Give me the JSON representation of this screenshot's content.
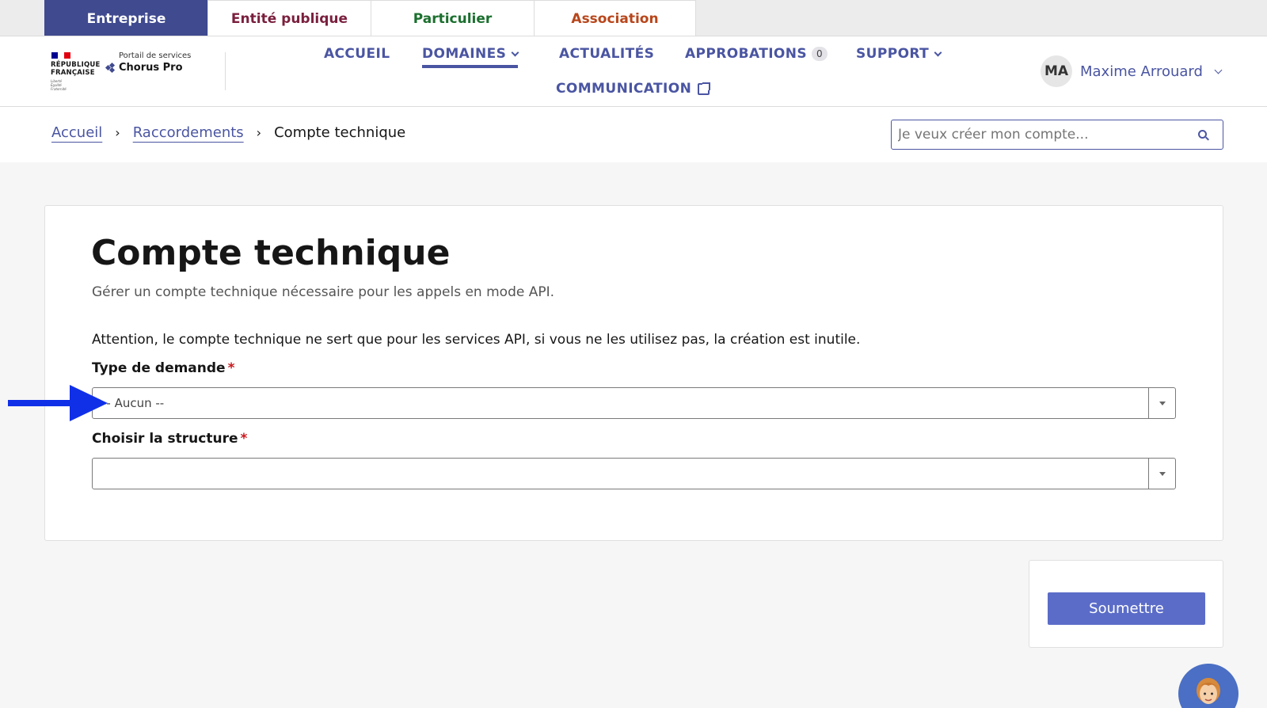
{
  "audience_tabs": [
    {
      "label": "Entreprise",
      "color": "#ffffff",
      "active": true
    },
    {
      "label": "Entité publique",
      "color": "#7a1f3d",
      "active": false
    },
    {
      "label": "Particulier",
      "color": "#1b6f2e",
      "active": false
    },
    {
      "label": "Association",
      "color": "#b8461b",
      "active": false
    }
  ],
  "logo": {
    "republic": "RÉPUBLIQUE\nFRANÇAISE",
    "motto": "Liberté\nÉgalité\nFraternité",
    "portal_label": "Portail de services",
    "app_name": "Chorus Pro"
  },
  "nav": {
    "accueil": "ACCUEIL",
    "domaines": "DOMAINES",
    "actualites": "ACTUALITÉS",
    "approbations": "APPROBATIONS",
    "approbations_count": "0",
    "support": "SUPPORT",
    "communication": "COMMUNICATION"
  },
  "user": {
    "initials": "MA",
    "name": "Maxime Arrouard"
  },
  "breadcrumb": {
    "home": "Accueil",
    "section": "Raccordements",
    "current": "Compte technique",
    "separator": "›"
  },
  "search": {
    "placeholder": "Je veux créer mon compte..."
  },
  "form": {
    "title": "Compte technique",
    "subtitle": "Gérer un compte technique nécessaire pour les appels en mode API.",
    "warning": "Attention, le compte technique ne sert que pour les services API, si vous ne les utilisez pas, la création est inutile.",
    "request_type_label": "Type de demande",
    "request_type_value": "-- Aucun --",
    "structure_label": "Choisir la structure",
    "structure_value": "",
    "required_mark": "*"
  },
  "submit": {
    "label": "Soumettre"
  },
  "colors": {
    "primary": "#3f4a8f",
    "nav_text": "#4a55a2",
    "button": "#5b6cc8",
    "required": "#c9191e",
    "annotation_arrow": "#1030e8"
  }
}
